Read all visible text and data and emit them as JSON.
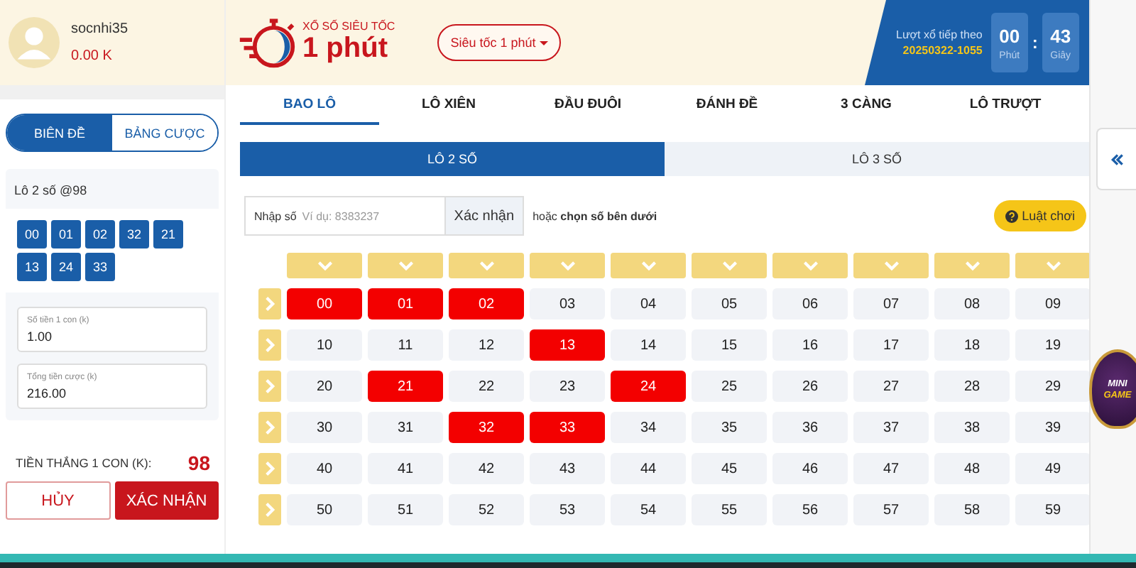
{
  "user": {
    "name": "socnhi35",
    "balance": "0.00 K"
  },
  "side_tabs": [
    {
      "label": "BIÊN ĐỀ",
      "selected": true
    },
    {
      "label": "BẢNG CƯỢC",
      "selected": false
    }
  ],
  "bet_summary": {
    "title": "Lô 2 số @98",
    "numbers": [
      "00",
      "01",
      "02",
      "32",
      "21",
      "13",
      "24",
      "33"
    ]
  },
  "fields": [
    {
      "label": "Số tiền 1 con (k)",
      "value": "1.00"
    },
    {
      "label": "Tổng tiền cược (k)",
      "value": "216.00"
    }
  ],
  "win": {
    "label": "TIỀN THẮNG 1 CON (K):",
    "value": "98"
  },
  "actions": [
    {
      "label": "HỦY",
      "kind": "outline"
    },
    {
      "label": "XÁC NHẬN",
      "kind": "solid"
    }
  ],
  "logo": {
    "subtitle": "XỔ SỐ SIÊU TỐC",
    "title": "1 phút"
  },
  "game_select": {
    "label": "Siêu tốc 1 phút"
  },
  "next_draw": {
    "label": "Lượt xổ tiếp theo",
    "id": "20250322-1055",
    "minutes": "00",
    "minutes_unit": "Phút",
    "separator": ":",
    "seconds": "43",
    "seconds_unit": "Giây"
  },
  "tabs": [
    {
      "label": "BAO LÔ",
      "selected": true
    },
    {
      "label": "LÔ XIÊN",
      "selected": false
    },
    {
      "label": "ĐẦU ĐUÔI",
      "selected": false
    },
    {
      "label": "ĐÁNH ĐỀ",
      "selected": false
    },
    {
      "label": "3 CÀNG",
      "selected": false
    },
    {
      "label": "LÔ TRƯỢT",
      "selected": false
    }
  ],
  "sub_tabs": [
    {
      "label": "LÔ 2 SỐ",
      "selected": true
    },
    {
      "label": "LÔ 3 SỐ",
      "selected": false
    }
  ],
  "number_input": {
    "label": "Nhập số",
    "placeholder": "Ví dụ: 8383237",
    "button": "Xác nhận",
    "hint": "hoặc **chọn số bên dưới**"
  },
  "rules_button": {
    "label": "Luật chơi"
  },
  "grid": [
    [
      {
        "n": "00",
        "selected": true
      },
      {
        "n": "01",
        "selected": true
      },
      {
        "n": "02",
        "selected": true
      },
      {
        "n": "03",
        "selected": false
      },
      {
        "n": "04",
        "selected": false
      },
      {
        "n": "05",
        "selected": false
      },
      {
        "n": "06",
        "selected": false
      },
      {
        "n": "07",
        "selected": false
      },
      {
        "n": "08",
        "selected": false
      },
      {
        "n": "09",
        "selected": false
      }
    ],
    [
      {
        "n": "10",
        "selected": false
      },
      {
        "n": "11",
        "selected": false
      },
      {
        "n": "12",
        "selected": false
      },
      {
        "n": "13",
        "selected": true
      },
      {
        "n": "14",
        "selected": false
      },
      {
        "n": "15",
        "selected": false
      },
      {
        "n": "16",
        "selected": false
      },
      {
        "n": "17",
        "selected": false
      },
      {
        "n": "18",
        "selected": false
      },
      {
        "n": "19",
        "selected": false
      }
    ],
    [
      {
        "n": "20",
        "selected": false
      },
      {
        "n": "21",
        "selected": true
      },
      {
        "n": "22",
        "selected": false
      },
      {
        "n": "23",
        "selected": false
      },
      {
        "n": "24",
        "selected": true
      },
      {
        "n": "25",
        "selected": false
      },
      {
        "n": "26",
        "selected": false
      },
      {
        "n": "27",
        "selected": false
      },
      {
        "n": "28",
        "selected": false
      },
      {
        "n": "29",
        "selected": false
      }
    ],
    [
      {
        "n": "30",
        "selected": false
      },
      {
        "n": "31",
        "selected": false
      },
      {
        "n": "32",
        "selected": true
      },
      {
        "n": "33",
        "selected": true
      },
      {
        "n": "34",
        "selected": false
      },
      {
        "n": "35",
        "selected": false
      },
      {
        "n": "36",
        "selected": false
      },
      {
        "n": "37",
        "selected": false
      },
      {
        "n": "38",
        "selected": false
      },
      {
        "n": "39",
        "selected": false
      }
    ],
    [
      {
        "n": "40",
        "selected": false
      },
      {
        "n": "41",
        "selected": false
      },
      {
        "n": "42",
        "selected": false
      },
      {
        "n": "43",
        "selected": false
      },
      {
        "n": "44",
        "selected": false
      },
      {
        "n": "45",
        "selected": false
      },
      {
        "n": "46",
        "selected": false
      },
      {
        "n": "47",
        "selected": false
      },
      {
        "n": "48",
        "selected": false
      },
      {
        "n": "49",
        "selected": false
      }
    ],
    [
      {
        "n": "50",
        "selected": false
      },
      {
        "n": "51",
        "selected": false
      },
      {
        "n": "52",
        "selected": false
      },
      {
        "n": "53",
        "selected": false
      },
      {
        "n": "54",
        "selected": false
      },
      {
        "n": "55",
        "selected": false
      },
      {
        "n": "56",
        "selected": false
      },
      {
        "n": "57",
        "selected": false
      },
      {
        "n": "58",
        "selected": false
      },
      {
        "n": "59",
        "selected": false
      }
    ]
  ],
  "mini_game": {
    "line1": "MINI",
    "line2": "GAME"
  }
}
